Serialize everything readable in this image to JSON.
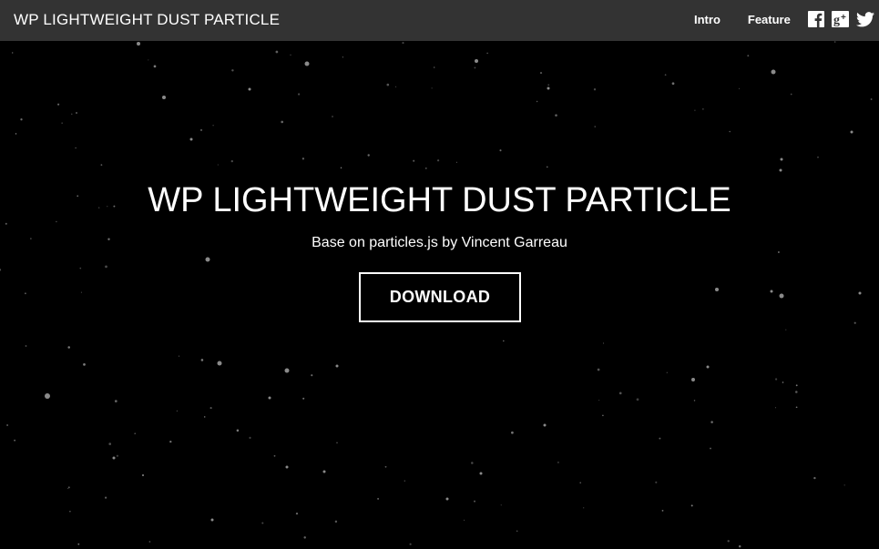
{
  "header": {
    "brand": "WP LIGHTWEIGHT DUST PARTICLE",
    "nav": [
      {
        "label": "Intro"
      },
      {
        "label": "Feature"
      }
    ],
    "social_icons": [
      "facebook-icon",
      "google-plus-icon",
      "twitter-icon"
    ]
  },
  "hero": {
    "title": "WP LIGHTWEIGHT DUST PARTICLE",
    "subtitle": "Base on particles.js by Vincent Garreau",
    "download_label": "DOWNLOAD"
  },
  "colors": {
    "navbar": "#333333",
    "background": "#000000",
    "text": "#ffffff",
    "particle": "#8a8a8a"
  }
}
